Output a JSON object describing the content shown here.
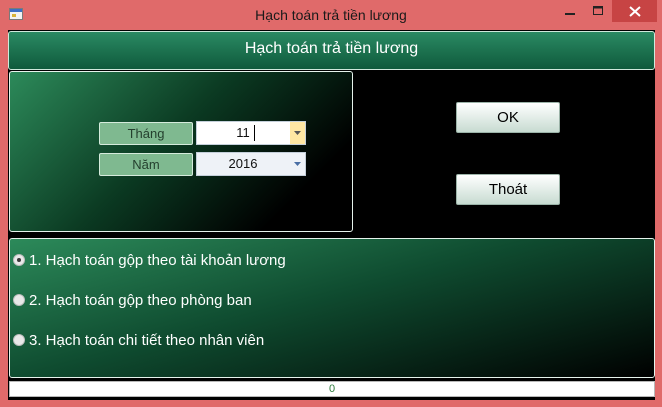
{
  "window": {
    "title": "Hạch toán trả tiền lương"
  },
  "header": {
    "title": "Hạch toán trả tiền lương"
  },
  "period": {
    "month_label": "Tháng",
    "month_value": "11",
    "year_label": "Năm",
    "year_value": "2016"
  },
  "actions": {
    "ok_label": "OK",
    "exit_label": "Thoát"
  },
  "options": [
    {
      "label": "1. Hạch toán gộp theo tài khoản lương",
      "selected": true
    },
    {
      "label": "2. Hạch toán gộp theo phòng ban",
      "selected": false
    },
    {
      "label": "3. Hạch toán chi tiết theo nhân viên",
      "selected": false
    }
  ],
  "progress": {
    "value": 0,
    "text": "0"
  },
  "colors": {
    "title_bar": "#e06a6a",
    "header": "#1f7a55",
    "label_bg": "#7fb990",
    "close_button": "#c74444"
  }
}
